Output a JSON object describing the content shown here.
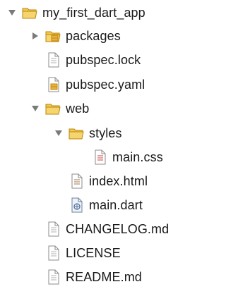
{
  "tree": {
    "items": [
      {
        "label": "my_first_dart_app",
        "icon": "folder-open-icon",
        "expanded": true
      },
      {
        "label": "packages",
        "icon": "folder-package-icon",
        "expanded": false
      },
      {
        "label": "pubspec.lock",
        "icon": "file-icon"
      },
      {
        "label": "pubspec.yaml",
        "icon": "file-yaml-icon"
      },
      {
        "label": "web",
        "icon": "folder-open-icon",
        "expanded": true
      },
      {
        "label": "styles",
        "icon": "folder-open-icon",
        "expanded": true
      },
      {
        "label": "main.css",
        "icon": "css-file-icon"
      },
      {
        "label": "index.html",
        "icon": "html-file-icon"
      },
      {
        "label": "main.dart",
        "icon": "dart-file-icon"
      },
      {
        "label": "CHANGELOG.md",
        "icon": "file-icon"
      },
      {
        "label": "LICENSE",
        "icon": "file-icon"
      },
      {
        "label": "README.md",
        "icon": "file-icon"
      }
    ]
  },
  "colors": {
    "folder": "#f3c84f",
    "folder_stroke": "#b8860b",
    "twisty": "#7a7a7a",
    "file_stroke": "#8b8b8b",
    "file_fill": "#ffffff",
    "css_accent": "#d23c3c",
    "package_accent": "#c88a00"
  }
}
